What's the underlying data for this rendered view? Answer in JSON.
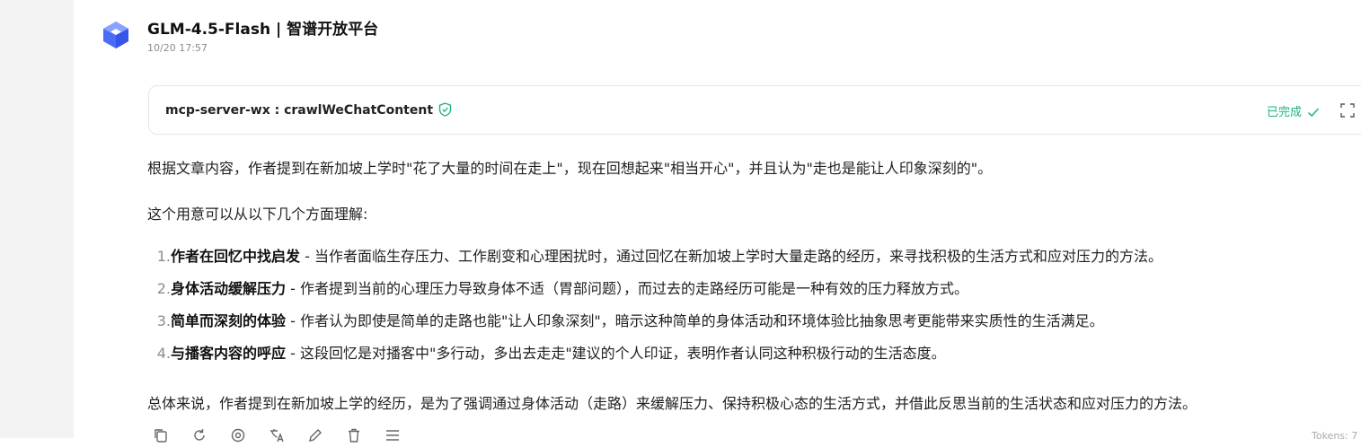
{
  "message": {
    "title": "GLM-4.5-Flash | 智谱开放平台",
    "timestamp": "10/20 17:57",
    "avatar_icon": "cube-logo-icon"
  },
  "tool_call": {
    "name": "mcp-server-wx : crawlWeChatContent",
    "verified_icon": "shield-check-icon",
    "status": "已完成",
    "status_color": "#1fb377",
    "expand_icon": "expand-icon"
  },
  "content": {
    "intro": "根据文章内容，作者提到在新加坡上学时\"花了大量的时间在走上\"，现在回想起来\"相当开心\"，并且认为\"走也是能让人印象深刻的\"。",
    "lead": "这个用意可以从以下几个方面理解:",
    "items": [
      {
        "num": "1.",
        "title": "作者在回忆中找启发",
        "text": " - 当作者面临生存压力、工作剧变和心理困扰时，通过回忆在新加坡上学时大量走路的经历，来寻找积极的生活方式和应对压力的方法。"
      },
      {
        "num": "2.",
        "title": "身体活动缓解压力",
        "text": " - 作者提到当前的心理压力导致身体不适（胃部问题），而过去的走路经历可能是一种有效的压力释放方式。"
      },
      {
        "num": "3.",
        "title": "简单而深刻的体验",
        "text": " - 作者认为即使是简单的走路也能\"让人印象深刻\"，暗示这种简单的身体活动和环境体验比抽象思考更能带来实质性的生活满足。"
      },
      {
        "num": "4.",
        "title": "与播客内容的呼应",
        "text": " - 这段回忆是对播客中\"多行动，多出去走走\"建议的个人印证，表明作者认同这种积极行动的生活态度。"
      }
    ],
    "conclusion": "总体来说，作者提到在新加坡上学的经历，是为了强调通过身体活动（走路）来缓解压力、保持积极心态的生活方式，并借此反思当前的生活状态和应对压力的方法。"
  },
  "actions": [
    "copy-icon",
    "regenerate-icon",
    "mention-icon",
    "translate-icon",
    "edit-icon",
    "delete-icon",
    "menu-icon"
  ],
  "footer": {
    "tokens": "Tokens: 7"
  }
}
